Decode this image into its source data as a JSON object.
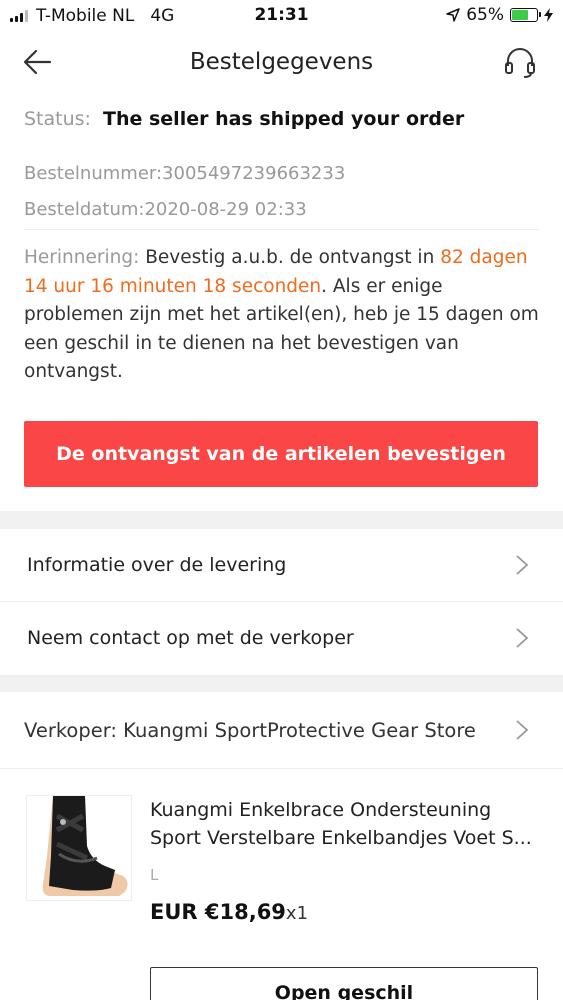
{
  "statusbar": {
    "carrier": "T-Mobile NL",
    "network": "4G",
    "time": "21:31",
    "battery_percent": "65%",
    "battery_level": 0.65,
    "battery_color": "#3dcc4a"
  },
  "header": {
    "title": "Bestelgegevens",
    "back_icon": "arrow-left-icon",
    "support_icon": "headset-icon"
  },
  "order": {
    "status_label": "Status:",
    "status_value": "The seller has shipped your order",
    "order_number": "Bestelnummer:3005497239663233",
    "order_date": "Besteldatum:2020-08-29 02:33",
    "reminder_label": "Herinnering:",
    "reminder_text_1": "Bevestig a.u.b. de ontvangst in",
    "reminder_countdown": "82 dagen 14 uur 16 minuten 18 seconden",
    "reminder_text_2": ". Als er enige problemen zijn met het artikel(en), heb je 15 dagen om een geschil in te dienen na het bevestigen van ontvangst.",
    "confirm_button": "De ontvangst van de artikelen bevestigen"
  },
  "links": {
    "delivery_info": "Informatie over de levering",
    "contact_seller": "Neem contact op met de verkoper"
  },
  "seller": {
    "label": "Verkoper: Kuangmi SportProtective Gear Store"
  },
  "product": {
    "title_line_1": "Kuangmi Enkelbrace Ondersteuning",
    "title_line_2": "Sport Verstelbare Enkelbandjes Voet S...",
    "variant": "L",
    "price": "EUR €18,69",
    "quantity": "x1",
    "dispute_button": "Open geschil"
  },
  "colors": {
    "accent_red": "#fa4646",
    "countdown_orange": "#f26a1b"
  }
}
